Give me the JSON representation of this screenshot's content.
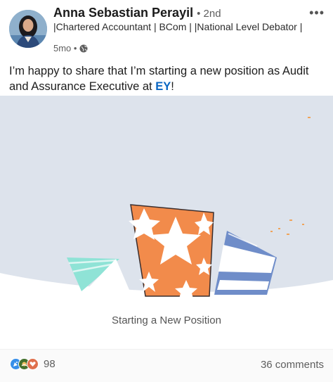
{
  "post": {
    "author": {
      "name": "Anna Sebastian Perayil",
      "degree": "• 2nd",
      "headline": "|Chartered Accountant | BCom | |National Level Debator |",
      "time": "5mo •"
    },
    "text_before": "I’m happy to share that I’m starting a new position as Audit and Assurance Executive at ",
    "company": "EY",
    "text_after": "!",
    "media": {
      "caption": "Starting a New Position"
    },
    "social": {
      "reaction_count": "98",
      "comments": "36 comments"
    },
    "icons": {
      "more": "more-options-icon",
      "visibility": "globe-icon",
      "reactions": [
        "celebrate-icon",
        "support-icon",
        "love-icon"
      ]
    },
    "colors": {
      "link": "#0a66c2",
      "banner_background": "#dde3ec",
      "hat_orange": "#f28b4b",
      "hat_teal": "#8fe3d6",
      "hat_blue": "#6f8dc9"
    }
  }
}
